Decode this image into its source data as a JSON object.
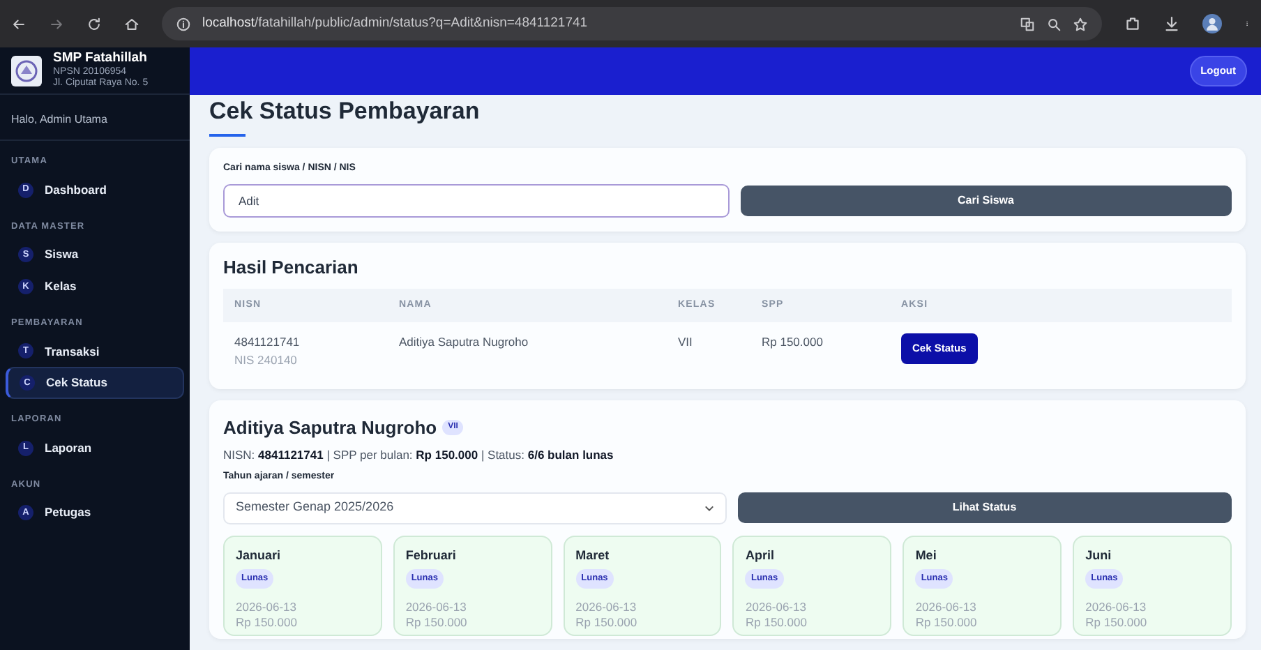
{
  "browser": {
    "url": "localhost/fatahillah/public/admin/status?q=Adit&nisn=4841121741"
  },
  "sidebar": {
    "brand": {
      "name": "SMP Fatahillah",
      "npsn": "NPSN 20106954",
      "address": "Jl. Ciputat Raya No. 5"
    },
    "greeting": "Halo, Admin Utama",
    "sections": [
      {
        "heading": "UTAMA",
        "items": [
          {
            "letter": "D",
            "label": "Dashboard",
            "selected": false
          }
        ]
      },
      {
        "heading": "DATA MASTER",
        "items": [
          {
            "letter": "S",
            "label": "Siswa",
            "selected": false
          },
          {
            "letter": "K",
            "label": "Kelas",
            "selected": false
          }
        ]
      },
      {
        "heading": "PEMBAYARAN",
        "items": [
          {
            "letter": "T",
            "label": "Transaksi",
            "selected": false
          },
          {
            "letter": "C",
            "label": "Cek Status",
            "selected": true
          }
        ]
      },
      {
        "heading": "LAPORAN",
        "items": [
          {
            "letter": "L",
            "label": "Laporan",
            "selected": false
          }
        ]
      },
      {
        "heading": "AKUN",
        "items": [
          {
            "letter": "A",
            "label": "Petugas",
            "selected": false
          }
        ]
      }
    ]
  },
  "topbar": {
    "logout": "Logout"
  },
  "page_title": "Cek Status Pembayaran",
  "search": {
    "label": "Cari nama siswa / NISN / NIS",
    "value": "Adit",
    "button": "Cari Siswa"
  },
  "results": {
    "title": "Hasil Pencarian",
    "columns": [
      "NISN",
      "NAMA",
      "KELAS",
      "SPP",
      "AKSI"
    ],
    "rows": [
      {
        "nisn": "4841121741",
        "nis": "NIS 240140",
        "name": "Aditiya Saputra Nugroho",
        "kelas": "VII",
        "spp": "Rp 150.000",
        "action": "Cek Status"
      }
    ]
  },
  "detail": {
    "name": "Aditiya Saputra Nugroho",
    "class_badge": "VII",
    "info": "NISN: **4841121741** | SPP per bulan: **Rp 150.000** | Status: **6/6 bulan lunas**",
    "select_label": "Tahun ajaran / semester",
    "select_value": "Semester Genap 2025/2026",
    "button": "Lihat Status",
    "months": [
      {
        "month": "Januari",
        "status": "Lunas",
        "paid": true,
        "date": "2026-06-13",
        "amount": "Rp 150.000"
      },
      {
        "month": "Februari",
        "status": "Lunas",
        "paid": true,
        "date": "2026-06-13",
        "amount": "Rp 150.000"
      },
      {
        "month": "Maret",
        "status": "Lunas",
        "paid": true,
        "date": "2026-06-13",
        "amount": "Rp 150.000"
      },
      {
        "month": "April",
        "status": "Lunas",
        "paid": true,
        "date": "2026-06-13",
        "amount": "Rp 150.000"
      },
      {
        "month": "Mei",
        "status": "Lunas",
        "paid": true,
        "date": "2026-06-13",
        "amount": "Rp 150.000"
      },
      {
        "month": "Juni",
        "status": "Lunas",
        "paid": true,
        "date": "2026-06-13",
        "amount": "Rp 150.000"
      }
    ]
  }
}
